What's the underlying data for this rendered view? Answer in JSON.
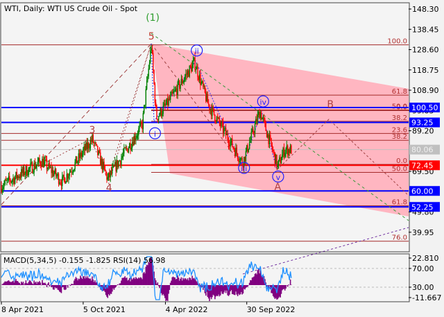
{
  "header": {
    "title": "WTI, Daily:  WTI US Crude Oil - Spot"
  },
  "indicator": {
    "label": "MACD(5,34,5) -0.155 -1.825 RSI(14) 56.98"
  },
  "chart_data": {
    "type": "candlestick",
    "title": "WTI, Daily: WTI US Crude Oil - Spot",
    "ylim": [
      35,
      150
    ],
    "y_ticks": [
      "148.30",
      "138.45",
      "128.60",
      "118.75",
      "108.90",
      "99.05",
      "89.20",
      "69.50",
      "49.80",
      "39.95"
    ],
    "y_tick_values": [
      148.3,
      138.45,
      128.6,
      118.75,
      108.9,
      99.05,
      89.2,
      69.5,
      49.8,
      39.95
    ],
    "x_ticks": [
      {
        "label": "8 Apr 2021",
        "day": 0
      },
      {
        "label": "5 Oct 2021",
        "day": 180
      },
      {
        "label": "4 Apr 2022",
        "day": 361
      },
      {
        "label": "30 Sep 2022",
        "day": 540
      }
    ],
    "price_path": [
      [
        0,
        62.4
      ],
      [
        89,
        74.5
      ],
      [
        134,
        64.5
      ],
      [
        200,
        85
      ],
      [
        234,
        65.8
      ],
      [
        310,
        92
      ],
      [
        330,
        130.8
      ],
      [
        341,
        95.5
      ],
      [
        364,
        102
      ],
      [
        425,
        122.4
      ],
      [
        455,
        102
      ],
      [
        531,
        73.6
      ],
      [
        569,
        98.8
      ],
      [
        608,
        71.9
      ],
      [
        623,
        80
      ],
      [
        638,
        80
      ]
    ],
    "price_labels": [
      {
        "text": "100.50",
        "value": 100.5,
        "color": "#0000ff"
      },
      {
        "text": "93.25",
        "value": 93.25,
        "color": "#0000ff"
      },
      {
        "text": "80.06",
        "value": 80.06,
        "color": "#c0c0c0"
      },
      {
        "text": "72.45",
        "value": 72.45,
        "color": "#ff0000"
      },
      {
        "text": "60.00",
        "value": 60.0,
        "color": "#0000ff"
      },
      {
        "text": "52.25",
        "value": 52.25,
        "color": "#0000ff"
      }
    ],
    "fib_levels": [
      {
        "text": "100.0",
        "value": 130.9
      },
      {
        "text": "61.8",
        "value": 106.5
      },
      {
        "text": "50.0",
        "value": 99.3
      },
      {
        "text": "0.0",
        "value": 99.0
      },
      {
        "text": "38.2",
        "value": 93.8
      },
      {
        "text": "23.6",
        "value": 87.9
      },
      {
        "text": "38.2",
        "value": 84.6
      },
      {
        "text": "0.0",
        "value": 72.9
      },
      {
        "text": "50.0",
        "value": 69.0
      },
      {
        "text": "61.8",
        "value": 52.8
      },
      {
        "text": "76.0",
        "value": 35.6
      }
    ],
    "wave_labels": [
      {
        "text": "(1)",
        "day": 333,
        "price": 142.5,
        "color": "#2e9d2e",
        "circle": false
      },
      {
        "text": "5",
        "day": 330,
        "price": 133.5,
        "color": "#c0392b",
        "circle": false
      },
      {
        "text": "3",
        "day": 200,
        "price": 88,
        "color": "#b04040",
        "circle": false
      },
      {
        "text": "4",
        "day": 237,
        "price": 60,
        "color": "#b04040",
        "circle": false
      },
      {
        "text": "i",
        "day": 338,
        "price": 86.3,
        "color": "#2020ff",
        "circle": true
      },
      {
        "text": "ii",
        "day": 430,
        "price": 126.5,
        "color": "#2020ff",
        "circle": true
      },
      {
        "text": "iii",
        "day": 534,
        "price": 69.5,
        "color": "#2020ff",
        "circle": true
      },
      {
        "text": "iv",
        "day": 576,
        "price": 101.8,
        "color": "#2020ff",
        "circle": true
      },
      {
        "text": "v",
        "day": 609,
        "price": 65.3,
        "color": "#2020ff",
        "circle": true
      },
      {
        "text": "A",
        "day": 608,
        "price": 60.5,
        "color": "#b04040",
        "circle": false
      },
      {
        "text": "B",
        "day": 724,
        "price": 100.5,
        "color": "#b04040",
        "circle": false
      }
    ],
    "indicator_axis": [
      "22.810",
      "70.00",
      "30.00",
      "-11.667"
    ]
  },
  "colors": {
    "bull": "#008000",
    "bear": "#ff0000",
    "channel": "#ffb6c1",
    "macd": "#800080",
    "rsi": "#1e90ff"
  }
}
